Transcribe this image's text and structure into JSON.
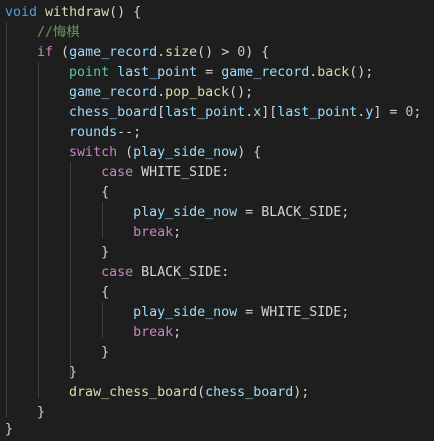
{
  "code": {
    "line1": {
      "kw_void": "void",
      "fn_name": "withdraw",
      "rest": "() {"
    },
    "line2": {
      "comment": "//悔棋"
    },
    "line3": {
      "kw_if": "if",
      "p1": " (",
      "var": "game_record",
      "dot": ".",
      "fn": "size",
      "p2": "() > ",
      "num": "0",
      "p3": ") {"
    },
    "line4": {
      "type": "point",
      "sp": " ",
      "var1": "last_point",
      "eq": " = ",
      "var2": "game_record",
      "dot": ".",
      "fn": "back",
      "end": "();"
    },
    "line5": {
      "var": "game_record",
      "dot": ".",
      "fn": "pop_back",
      "end": "();"
    },
    "line6": {
      "var1": "chess_board",
      "b1": "[",
      "var2": "last_point",
      "d1": ".",
      "mem1": "x",
      "b2": "][",
      "var3": "last_point",
      "d2": ".",
      "mem2": "y",
      "b3": "] = ",
      "num": "0",
      "end": ";"
    },
    "line7": {
      "var": "rounds",
      "end": "--;"
    },
    "line8": {
      "kw_switch": "switch",
      "p1": " (",
      "var": "play_side_now",
      "p2": ") {"
    },
    "line9": {
      "kw_case": "case",
      "sp": " ",
      "mac": "WHITE_SIDE",
      "end": ":"
    },
    "line10": {
      "brace": "{"
    },
    "line11": {
      "var": "play_side_now",
      "eq": " = ",
      "mac": "BLACK_SIDE",
      "end": ";"
    },
    "line12": {
      "kw_break": "break",
      "end": ";"
    },
    "line13": {
      "brace": "}"
    },
    "line14": {
      "kw_case": "case",
      "sp": " ",
      "mac": "BLACK_SIDE",
      "end": ":"
    },
    "line15": {
      "brace": "{"
    },
    "line16": {
      "var": "play_side_now",
      "eq": " = ",
      "mac": "WHITE_SIDE",
      "end": ";"
    },
    "line17": {
      "kw_break": "break",
      "end": ";"
    },
    "line18": {
      "brace": "}"
    },
    "line19": {
      "brace": "}"
    },
    "line20": {
      "fn": "draw_chess_board",
      "p1": "(",
      "var": "chess_board",
      "end": ");"
    },
    "line21": {
      "brace": "}"
    },
    "line22": {
      "brace": "}"
    }
  },
  "colors": {
    "background": "#1e1e1e",
    "keyword": "#569cd6",
    "control": "#c586c0",
    "function": "#dcdcaa",
    "variable": "#9cdcfe",
    "type": "#4ec9b0",
    "number": "#b5cea8",
    "comment": "#6a9955",
    "text": "#d4d4d4"
  }
}
